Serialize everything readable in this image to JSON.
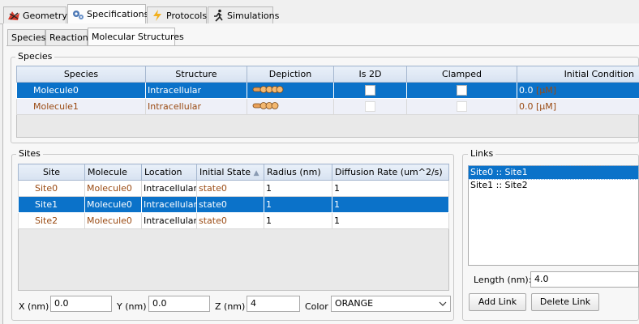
{
  "top_tabs": [
    {
      "label": "Geometry",
      "icon": "geometry-icon",
      "selected": false
    },
    {
      "label": "Specifications",
      "icon": "gear-icon",
      "selected": true
    },
    {
      "label": "Protocols",
      "icon": "lightning-icon",
      "selected": false
    },
    {
      "label": "Simulations",
      "icon": "runner-icon",
      "selected": false
    }
  ],
  "sub_tabs": [
    {
      "label": "Species",
      "selected": false
    },
    {
      "label": "Reaction",
      "selected": false
    },
    {
      "label": "Molecular Structures",
      "selected": true
    }
  ],
  "species_panel": {
    "title": "Species",
    "columns": [
      "Species",
      "Structure",
      "Depiction",
      "Is 2D",
      "Clamped",
      "Initial Condition"
    ],
    "rows": [
      {
        "species": "Molecule0",
        "structure": "Intracellular",
        "is_2d": false,
        "clamped": false,
        "initial_condition": "0.0",
        "unit": "[µM]",
        "selected": true
      },
      {
        "species": "Molecule1",
        "structure": "Intracellular",
        "is_2d": false,
        "clamped": false,
        "initial_condition": "0.0",
        "unit": "[µM]",
        "selected": false
      }
    ]
  },
  "sites_panel": {
    "title": "Sites",
    "columns": [
      "Site",
      "Molecule",
      "Location",
      "Initial State",
      "Radius (nm)",
      "Diffusion Rate (um^2/s)"
    ],
    "sort_indicator": "▲",
    "rows": [
      {
        "site": "Site0",
        "molecule": "Molecule0",
        "location": "Intracellular",
        "initial_state": "state0",
        "radius": "1",
        "diffusion_rate": "1",
        "selected": false
      },
      {
        "site": "Site1",
        "molecule": "Molecule0",
        "location": "Intracellular",
        "initial_state": "state0",
        "radius": "1",
        "diffusion_rate": "1",
        "selected": true
      },
      {
        "site": "Site2",
        "molecule": "Molecule0",
        "location": "Intracellular",
        "initial_state": "state0",
        "radius": "1",
        "diffusion_rate": "1",
        "selected": false
      }
    ],
    "x_label": "X (nm)",
    "x_value": "0.0",
    "y_label": "Y (nm)",
    "y_value": "0.0",
    "z_label": "Z (nm)",
    "z_value": "4",
    "color_label": "Color",
    "color_value": "ORANGE"
  },
  "links_panel": {
    "title": "Links",
    "items": [
      {
        "label": "Site0 :: Site1",
        "selected": true
      },
      {
        "label": "Site1 :: Site2",
        "selected": false
      }
    ],
    "length_label": "Length (nm):",
    "length_value": "4.0",
    "add_link_label": "Add Link",
    "delete_link_label": "Delete Link"
  },
  "colors": {
    "selection": "#0b72c9",
    "name_text": "#9a4a12",
    "header": "#dce6f3"
  }
}
